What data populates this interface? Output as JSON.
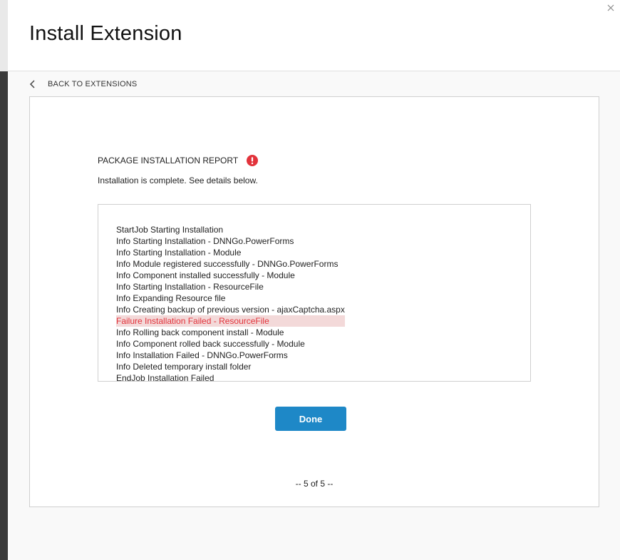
{
  "dialog": {
    "title": "Install Extension",
    "close_icon": "close-icon"
  },
  "nav": {
    "back_label": "BACK TO EXTENSIONS",
    "back_icon": "chevron-left-icon"
  },
  "report": {
    "title": "PACKAGE INSTALLATION REPORT",
    "alert_icon": "alert-circle-icon",
    "alert_color": "#e2333b",
    "subtitle": "Installation is complete. See details below.",
    "log": [
      {
        "text": "StartJob Starting Installation",
        "status": "normal"
      },
      {
        "text": "Info Starting Installation - DNNGo.PowerForms",
        "status": "normal"
      },
      {
        "text": "Info Starting Installation - Module",
        "status": "normal"
      },
      {
        "text": "Info Module registered successfully - DNNGo.PowerForms",
        "status": "normal"
      },
      {
        "text": "Info Component installed successfully - Module",
        "status": "normal"
      },
      {
        "text": "Info Starting Installation - ResourceFile",
        "status": "normal"
      },
      {
        "text": "Info Expanding Resource file",
        "status": "normal"
      },
      {
        "text": "Info Creating backup of previous version - ajaxCaptcha.aspx",
        "status": "normal"
      },
      {
        "text": "Failure Installation Failed - ResourceFile",
        "status": "failure"
      },
      {
        "text": "Info Rolling back component install - Module",
        "status": "normal"
      },
      {
        "text": "Info Component rolled back successfully - Module",
        "status": "normal"
      },
      {
        "text": "Info Installation Failed - DNNGo.PowerForms",
        "status": "normal"
      },
      {
        "text": "Info Deleted temporary install folder",
        "status": "normal"
      },
      {
        "text": "EndJob Installation Failed",
        "status": "normal"
      }
    ]
  },
  "actions": {
    "done_label": "Done",
    "done_color": "#1e88c7"
  },
  "pager": {
    "text": "-- 5 of 5 --"
  }
}
